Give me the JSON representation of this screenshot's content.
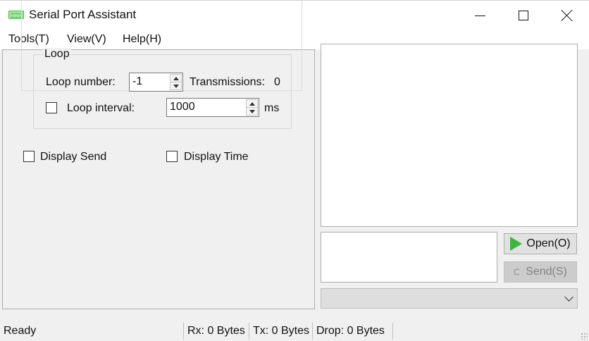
{
  "window": {
    "title": "Serial Port Assistant",
    "controls": [
      "minimize",
      "maximize",
      "close"
    ]
  },
  "menu": {
    "items": [
      "Tools(T)",
      "View(V)",
      "Help(H)"
    ]
  },
  "loop": {
    "group_title": "Loop",
    "number_label": "Loop number:",
    "number_value": "-1",
    "transmissions_label": "Transmissions:",
    "transmissions_value": "0",
    "interval_label": "Loop interval:",
    "interval_checked": false,
    "interval_value": "1000",
    "interval_unit": "ms"
  },
  "display": {
    "send_label": "Display Send",
    "send_checked": false,
    "time_label": "Display Time",
    "time_checked": false
  },
  "buttons": {
    "open_label": "Open(O)",
    "send_label": "Send(S)",
    "send_enabled": false
  },
  "status": {
    "state": "Ready",
    "rx": "Rx: 0 Bytes",
    "tx": "Tx: 0 Bytes",
    "drop": "Drop: 0 Bytes"
  },
  "colors": {
    "open_icon": "#3cb53c",
    "app_icon": "#9fe69f"
  }
}
